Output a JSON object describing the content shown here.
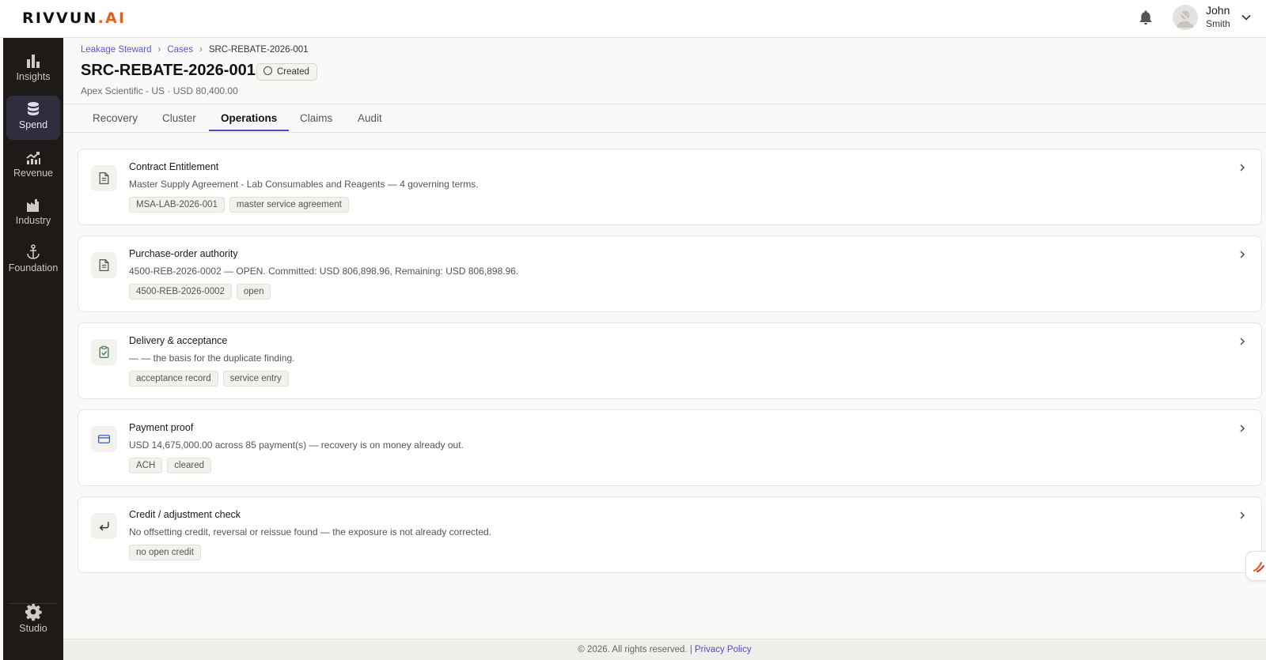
{
  "app": {
    "logo_main": "RIVVUN",
    "logo_accent": ".AI"
  },
  "user": {
    "first_name": "John",
    "last_name": "Smith"
  },
  "sidebar": {
    "items": [
      {
        "label": "Insights",
        "icon": "bar-chart-icon",
        "active": false
      },
      {
        "label": "Spend",
        "icon": "database-icon",
        "active": true
      },
      {
        "label": "Revenue",
        "icon": "revenue-chart-icon",
        "active": false
      },
      {
        "label": "Industry",
        "icon": "factory-icon",
        "active": false
      },
      {
        "label": "Foundation",
        "icon": "anchor-icon",
        "active": false
      }
    ],
    "bottom": {
      "label": "Studio",
      "icon": "gear-icon"
    }
  },
  "breadcrumb": {
    "items": [
      "Leakage Steward",
      "Cases",
      "SRC-REBATE-2026-001"
    ]
  },
  "case": {
    "title": "SRC-REBATE-2026-001",
    "status": "Created",
    "subtitle": "Apex Scientific - US · USD 80,400.00"
  },
  "tabs": [
    "Recovery",
    "Cluster",
    "Operations",
    "Claims",
    "Audit"
  ],
  "active_tab": "Operations",
  "cards": [
    {
      "title": "Contract Entitlement",
      "description": "Master Supply Agreement - Lab Consumables and Reagents — 4 governing terms.",
      "tags": [
        "MSA-LAB-2026-001",
        "master service agreement"
      ],
      "icon": "document-icon"
    },
    {
      "title": "Purchase-order authority",
      "description": "4500-REB-2026-0002 — OPEN. Committed: USD 806,898.96, Remaining: USD 806,898.96.",
      "tags": [
        "4500-REB-2026-0002",
        "open"
      ],
      "icon": "document-icon"
    },
    {
      "title": "Delivery & acceptance",
      "description": "— — the basis for the duplicate finding.",
      "tags": [
        "acceptance record",
        "service entry"
      ],
      "icon": "clipboard-check-icon"
    },
    {
      "title": "Payment proof",
      "description": "USD 14,675,000.00 across 85 payment(s) — recovery is on money already out.",
      "tags": [
        "ACH",
        "cleared"
      ],
      "icon": "credit-card-icon"
    },
    {
      "title": "Credit / adjustment check",
      "description": "No offsetting credit, reversal or reissue found — the exposure is not already corrected.",
      "tags": [
        "no open credit"
      ],
      "icon": "return-arrow-icon"
    }
  ],
  "footer": {
    "copyright": "© 2026. All rights reserved. |",
    "privacy_link": "Privacy Policy"
  },
  "colors": {
    "accent": "#4a4ad0",
    "brand_orange": "#e8611a",
    "sidebar_bg": "#1e1a17"
  }
}
